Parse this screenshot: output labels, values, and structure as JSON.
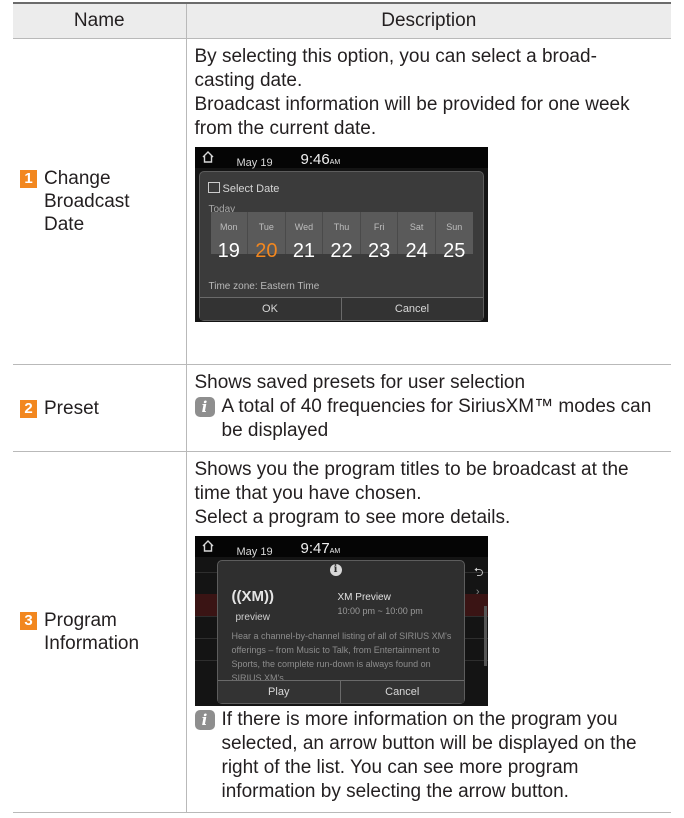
{
  "header": {
    "name": "Name",
    "description": "Description"
  },
  "rows": [
    {
      "number": "1",
      "name": "Change\nBroadcast\nDate",
      "lines": [
        "By selecting this option, you can select a broad-",
        "casting date.",
        "Broadcast information will be provided for one week",
        "from the current date."
      ],
      "screen": {
        "date": "May 19",
        "time": "9:46",
        "time_suffix": "AM",
        "title": "Select Date",
        "today_label": "Today",
        "days": [
          {
            "name": "Mon",
            "num": "19"
          },
          {
            "name": "Tue",
            "num": "20"
          },
          {
            "name": "Wed",
            "num": "21"
          },
          {
            "name": "Thu",
            "num": "22"
          },
          {
            "name": "Fri",
            "num": "23"
          },
          {
            "name": "Sat",
            "num": "24"
          },
          {
            "name": "Sun",
            "num": "25"
          }
        ],
        "selected_day": "Tue",
        "timezone": "Time zone: Eastern Time",
        "ok": "OK",
        "cancel": "Cancel"
      }
    },
    {
      "number": "2",
      "name": "Preset",
      "text": "Shows saved presets for user selection",
      "note": "A total of 40 frequencies for SiriusXM™ modes can be displayed"
    },
    {
      "number": "3",
      "name": "Program\nInformation",
      "lines": [
        "Shows you the program titles to be broadcast at the",
        "time that you have chosen.",
        "Select a program to see more details."
      ],
      "screen": {
        "date": "May 19",
        "time": "9:47",
        "time_suffix": "AM",
        "logo": "((XM))",
        "logo_sub": "preview",
        "program_title": "XM Preview",
        "program_time": "10:00 pm ~ 10:00 pm",
        "program_desc": "Hear a channel-by-channel listing of all of SIRIUS XM's offerings – from Music to Talk, from Entertainment to Sports, the complete run-down is always found on SIRIUS XM's...",
        "play": "Play",
        "cancel": "Cancel"
      },
      "note": "If there is more information on the program you selected, an arrow button will be displayed on the right of the list. You can see more program information by selecting the arrow button."
    }
  ],
  "colors": {
    "accent": "#f2871f",
    "header_bg": "#ececec",
    "border": "#b9b9b9"
  }
}
